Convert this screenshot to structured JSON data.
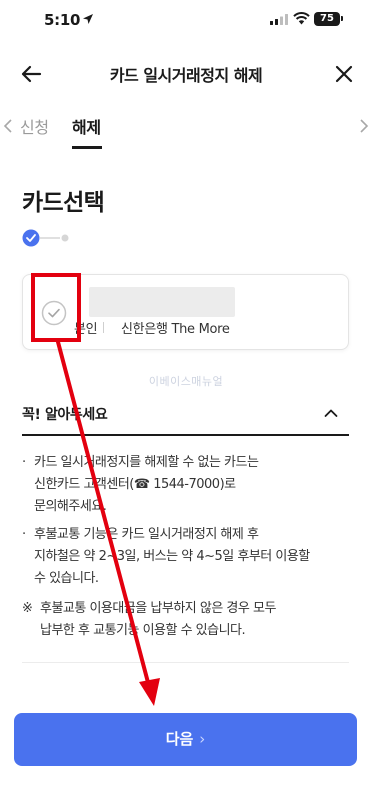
{
  "status_bar": {
    "time": "5:10",
    "battery": "75"
  },
  "header": {
    "title": "카드 일시거래정지 해제"
  },
  "tabs": [
    {
      "label": "신청",
      "active": false
    },
    {
      "label": "해제",
      "active": true
    }
  ],
  "section": {
    "title": "카드선택"
  },
  "card": {
    "owner": "본인",
    "name": "신한은행 The More"
  },
  "watermark": "이베이스매뉴얼",
  "notice": {
    "title": "꼭! 알아두세요",
    "items": [
      {
        "bullet": "·",
        "lines": [
          "카드 일시거래정지를 해제할 수 없는 카드는",
          "신한카드 고객센터(☎ 1544-7000)로",
          "문의해주세요."
        ]
      },
      {
        "bullet": "·",
        "lines": [
          "후불교통 기능은 카드 일시거래정지 해제 후",
          "지하철은 약 2~3일, 버스는 약 4~5일 후부터 이용할",
          "수 있습니다."
        ]
      },
      {
        "bullet": "※",
        "lines": [
          "후불교통 이용대금을 납부하지 않은 경우 모두",
          "납부한 후 교통기능 이용할 수 있습니다."
        ]
      }
    ]
  },
  "footer": {
    "next_label": "다음",
    "next_chevron": "›"
  },
  "colors": {
    "primary": "#4a72ee",
    "annotation": "#e3000f"
  }
}
